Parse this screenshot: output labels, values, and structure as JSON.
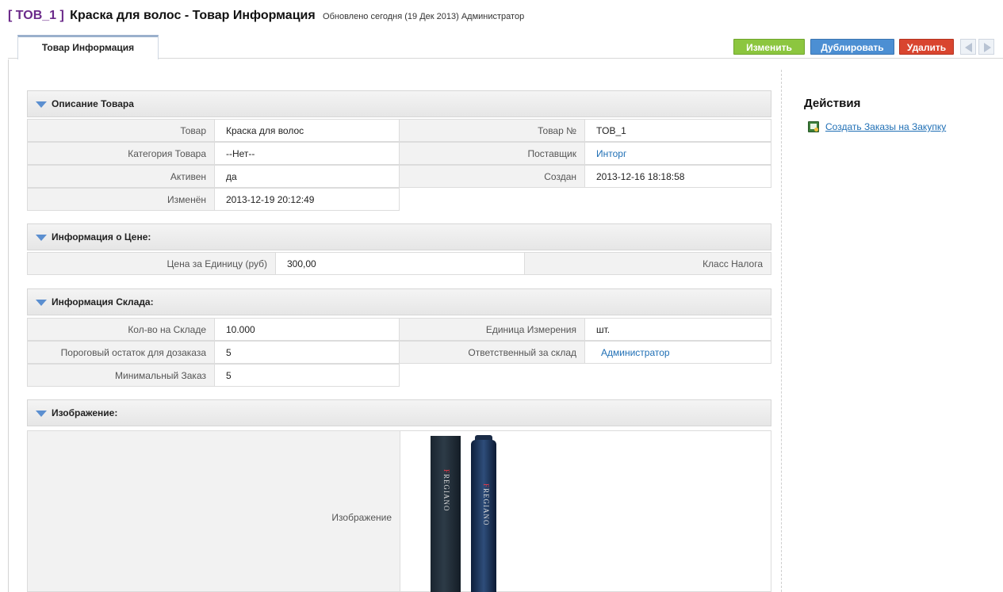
{
  "header": {
    "record_id": "[ TOB_1 ]",
    "title": "Краска для волос - Товар Информация",
    "updated": "Обновлено сегодня (19 Дек 2013) Администратор"
  },
  "tabs": [
    {
      "label": "Товар Информация",
      "active": true
    }
  ],
  "toolbar": {
    "edit_label": "Изменить",
    "duplicate_label": "Дублировать",
    "delete_label": "Удалить",
    "edit_color": "#8cc63f",
    "duplicate_color": "#4c8fd3",
    "delete_color": "#d9452f"
  },
  "sections": {
    "description": {
      "title": "Описание Товара",
      "product_label": "Товар",
      "product_value": "Краска для волос",
      "product_no_label": "Товар №",
      "product_no_value": "TOB_1",
      "category_label": "Категория Товара",
      "category_value": "--Нет--",
      "vendor_label": "Поставщик",
      "vendor_value": "Инторг",
      "active_label": "Активен",
      "active_value": "да",
      "created_label": "Создан",
      "created_value": "2013-12-16 18:18:58",
      "modified_label": "Изменён",
      "modified_value": "2013-12-19 20:12:49"
    },
    "pricing": {
      "title": "Информация о Цене:",
      "unit_price_label": "Цена за Единицу (руб)",
      "unit_price_value": "300,00",
      "tax_class_label": "Класс Налога"
    },
    "stock": {
      "title": "Информация Склада:",
      "qty_label": "Кол-во на Складе",
      "qty_value": "10.000",
      "unit_label": "Единица Измерения",
      "unit_value": "шт.",
      "reorder_label": "Пороговый остаток для дозаказа",
      "reorder_value": "5",
      "handler_label": "Ответственный за склад",
      "handler_value": "Администратор",
      "min_order_label": "Минимальный Заказ",
      "min_order_value": "5"
    },
    "image": {
      "title": "Изображение:",
      "label": "Изображение"
    }
  },
  "sidebar": {
    "title": "Действия",
    "action_label": "Создать Заказы на Закупку"
  }
}
